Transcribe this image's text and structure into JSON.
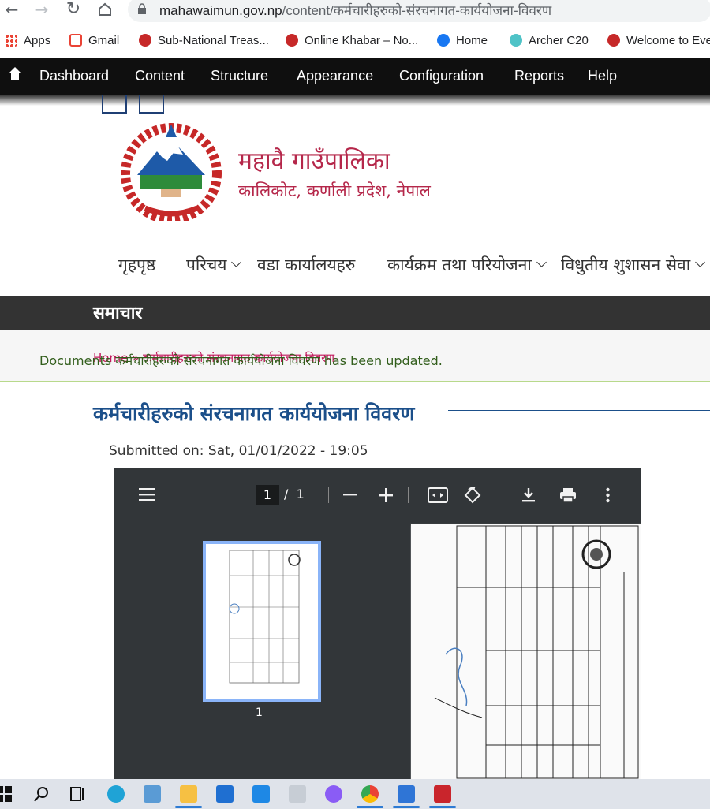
{
  "browser": {
    "url_domain": "mahawaimun.gov.np",
    "url_path": "/content/कर्मचारीहरुको-संरचनागत-कार्ययोजना-विवरण"
  },
  "bookmarks": [
    {
      "label": "Apps",
      "color": "#4285f4"
    },
    {
      "label": "Gmail",
      "color": "#ea4335"
    },
    {
      "label": "Sub-National Treas...",
      "color": "#c62828"
    },
    {
      "label": "Online Khabar – No...",
      "color": "#c62828"
    },
    {
      "label": "Home",
      "color": "#1877f2"
    },
    {
      "label": "Archer C20",
      "color": "#4fc3c7"
    },
    {
      "label": "Welcome to Eve",
      "color": "#c62828"
    }
  ],
  "admin_toolbar": {
    "items": [
      "Dashboard",
      "Content",
      "Structure",
      "Appearance",
      "Configuration",
      "Reports",
      "Help"
    ]
  },
  "site": {
    "name": "महावै गाउँपालिका",
    "slogan": "कालिकोट, कर्णाली प्रदेश, नेपाल"
  },
  "main_menu": [
    {
      "label": "गृहपृष्ठ",
      "dropdown": false
    },
    {
      "label": "परिचय",
      "dropdown": true
    },
    {
      "label": "वडा कार्यालयहरु",
      "dropdown": false
    },
    {
      "label": "कार्यक्रम तथा परियोजना",
      "dropdown": true
    },
    {
      "label": "विधुतीय शुशासन सेवा",
      "dropdown": true
    }
  ],
  "news_bar": {
    "title": "समाचार"
  },
  "breadcrumb": "Home » कर्मचारीहरुको संरचनागत कार्ययोजना विवरण",
  "status_message": "Documents कर्मचारीहरुको संरचनागत कार्ययोजना विवरण has been updated.",
  "page": {
    "title": "कर्मचारीहरुको संरचनागत कार्ययोजना विवरण",
    "submitted": "Submitted on: Sat, 01/01/2022 - 19:05"
  },
  "pdf_viewer": {
    "current_page": "1",
    "page_sep": "/",
    "total_pages": "1",
    "thumbnail_label": "1"
  },
  "colors": {
    "site_accent": "#b5274a",
    "title_blue": "#1b4f8a",
    "status_green": "#325e1c"
  }
}
